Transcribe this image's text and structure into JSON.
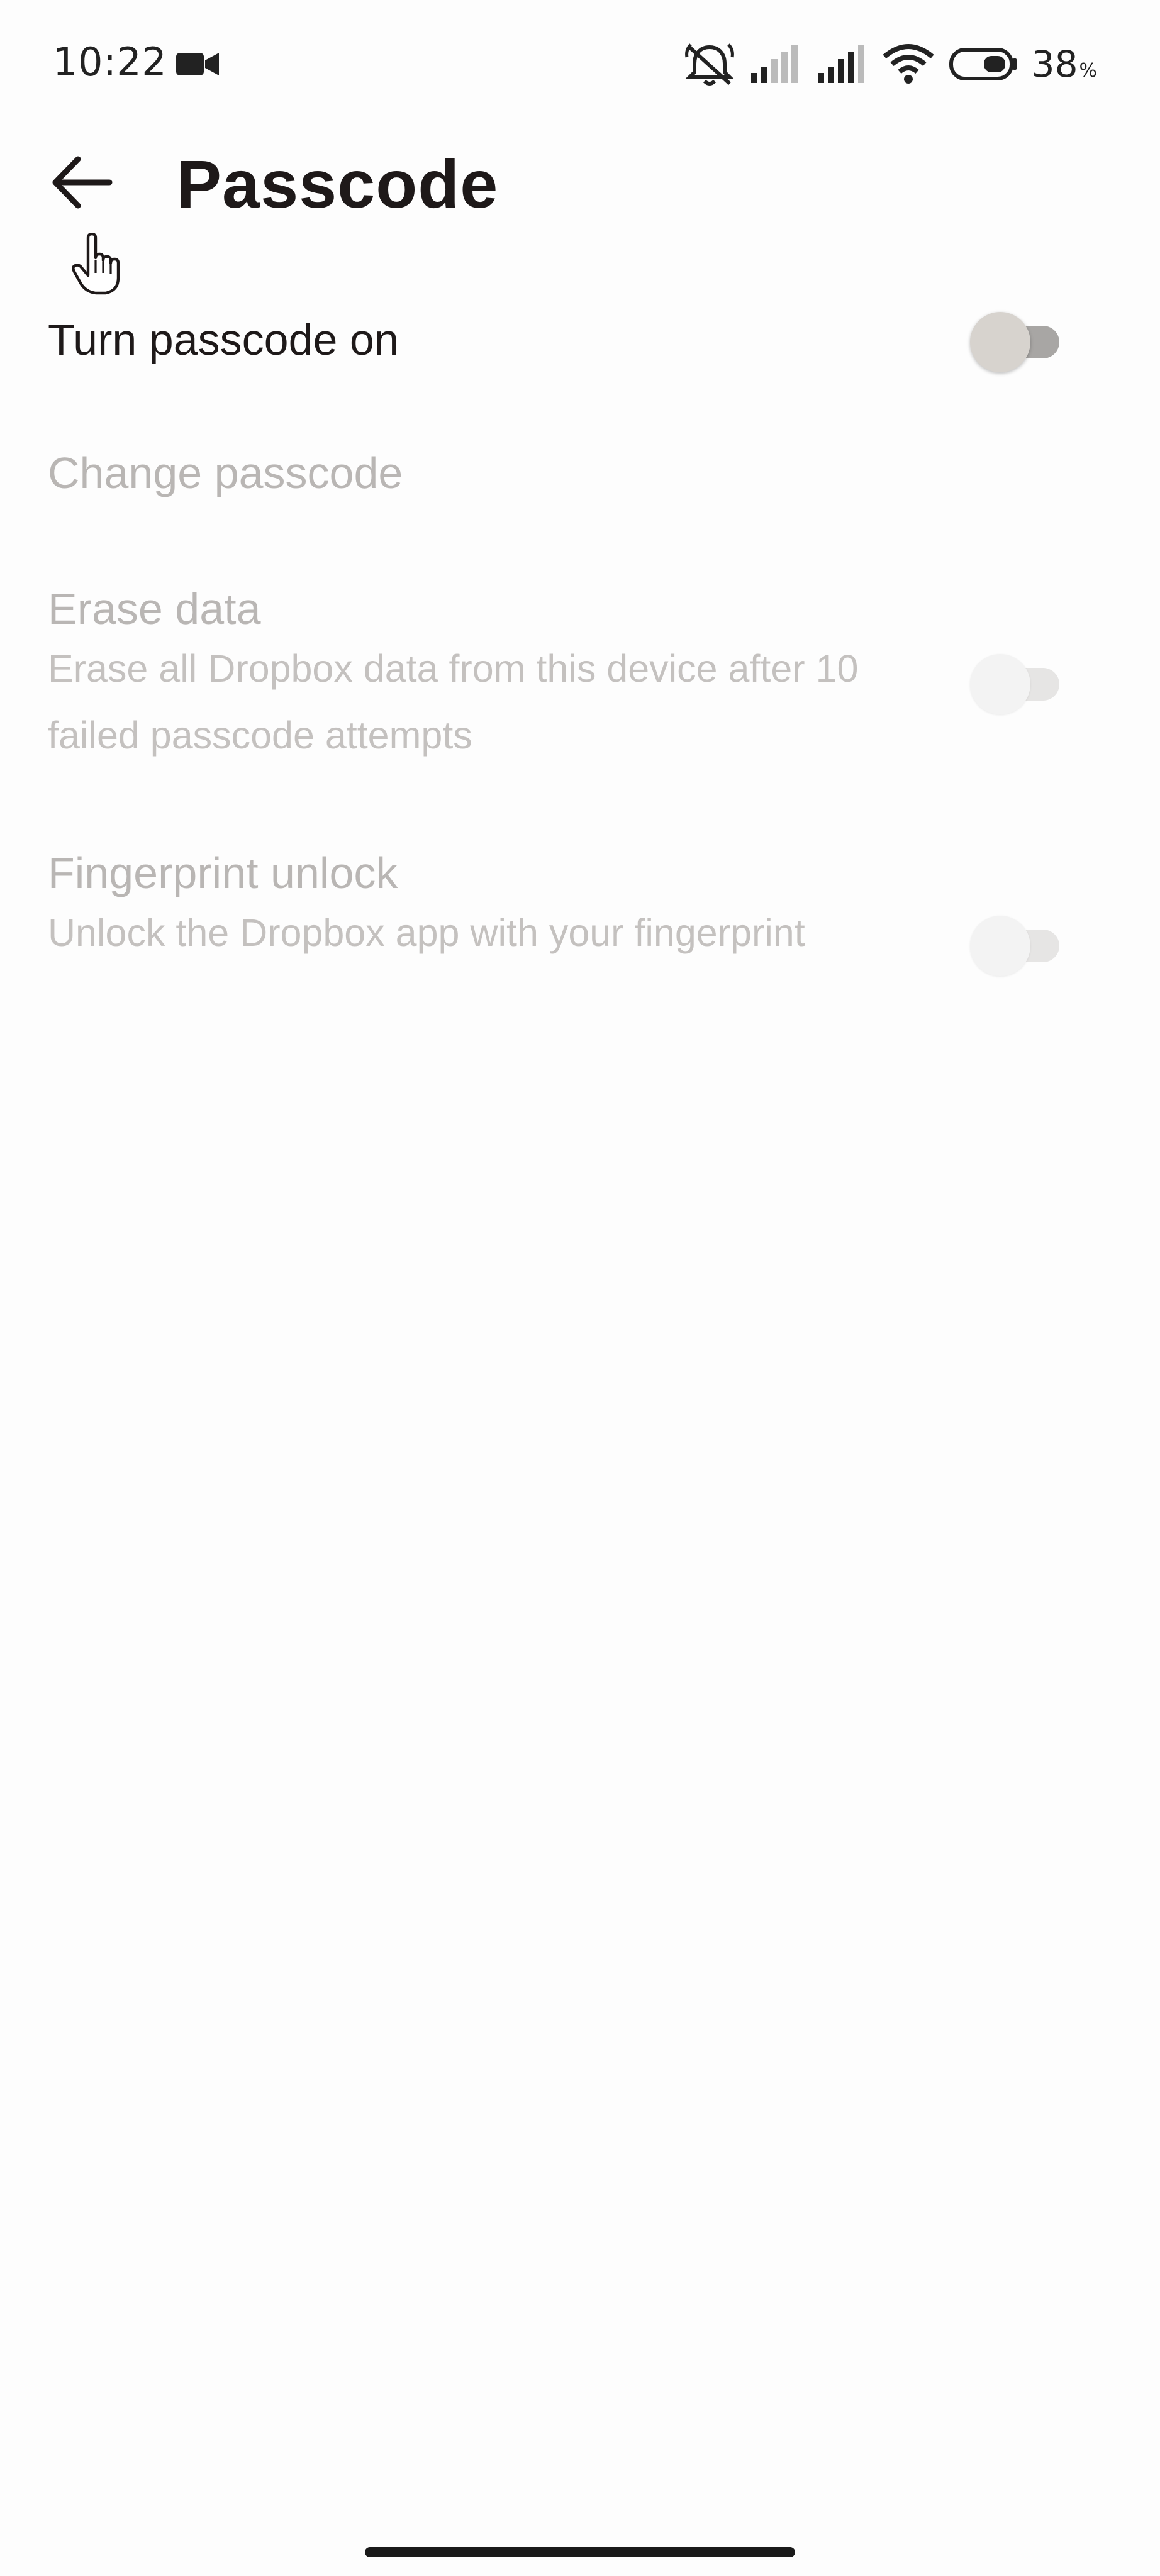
{
  "status_bar": {
    "time": "10:22",
    "battery_level": "38",
    "battery_unit": "%",
    "icons": [
      "video-camera-icon",
      "muted-alarm-icon",
      "signal-weak-icon",
      "signal-strong-icon",
      "wifi-icon",
      "battery-icon"
    ]
  },
  "app_bar": {
    "title": "Passcode",
    "back_icon": "arrow-left-icon"
  },
  "settings": {
    "turn_on": {
      "title": "Turn passcode on",
      "enabled": true,
      "toggle_on": false
    },
    "change": {
      "title": "Change passcode",
      "enabled": false
    },
    "erase": {
      "title": "Erase data",
      "description": "Erase all Dropbox data from this device after 10 failed passcode attempts",
      "enabled": false,
      "toggle_on": false
    },
    "fingerprint": {
      "title": "Fingerprint unlock",
      "description": "Unlock the Dropbox app with your fingerprint",
      "enabled": false,
      "toggle_on": false
    }
  },
  "colors": {
    "primary_text": "#1e1919",
    "disabled_text": "#b9b6b4",
    "background": "#fdfdfd"
  }
}
